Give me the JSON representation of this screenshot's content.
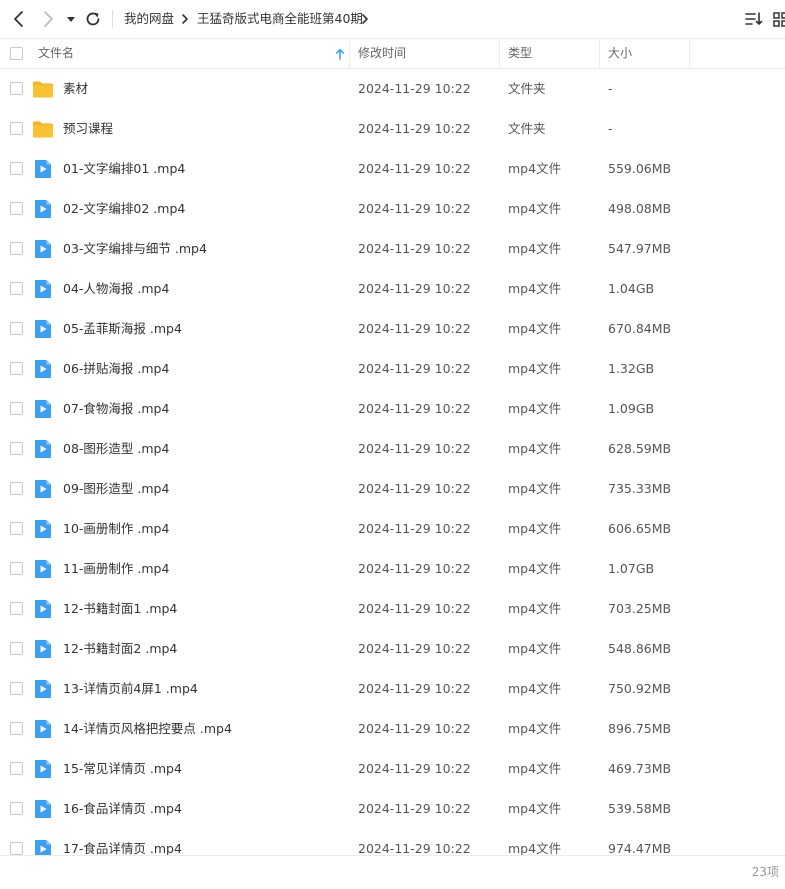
{
  "toolbar": {
    "back_icon": "chevron-left-icon",
    "forward_icon": "chevron-right-icon",
    "history_icon": "caret-down-icon",
    "refresh_icon": "refresh-icon",
    "sort_icon": "sort-list-icon",
    "view_icon": "grid-view-icon"
  },
  "breadcrumb": {
    "items": [
      "我的网盘",
      "王猛奇版式电商全能班第40期"
    ]
  },
  "columns": {
    "name": "文件名",
    "time": "修改时间",
    "type": "类型",
    "size": "大小"
  },
  "files": [
    {
      "name": "素材",
      "time": "2024-11-29 10:22",
      "type": "文件夹",
      "size": "-",
      "icon": "folder"
    },
    {
      "name": "预习课程",
      "time": "2024-11-29 10:22",
      "type": "文件夹",
      "size": "-",
      "icon": "folder"
    },
    {
      "name": "01-文字编排01 .mp4",
      "time": "2024-11-29 10:22",
      "type": "mp4文件",
      "size": "559.06MB",
      "icon": "video"
    },
    {
      "name": "02-文字编排02 .mp4",
      "time": "2024-11-29 10:22",
      "type": "mp4文件",
      "size": "498.08MB",
      "icon": "video"
    },
    {
      "name": "03-文字编排与细节 .mp4",
      "time": "2024-11-29 10:22",
      "type": "mp4文件",
      "size": "547.97MB",
      "icon": "video"
    },
    {
      "name": "04-人物海报 .mp4",
      "time": "2024-11-29 10:22",
      "type": "mp4文件",
      "size": "1.04GB",
      "icon": "video"
    },
    {
      "name": "05-孟菲斯海报 .mp4",
      "time": "2024-11-29 10:22",
      "type": "mp4文件",
      "size": "670.84MB",
      "icon": "video"
    },
    {
      "name": "06-拼贴海报 .mp4",
      "time": "2024-11-29 10:22",
      "type": "mp4文件",
      "size": "1.32GB",
      "icon": "video"
    },
    {
      "name": "07-食物海报 .mp4",
      "time": "2024-11-29 10:22",
      "type": "mp4文件",
      "size": "1.09GB",
      "icon": "video"
    },
    {
      "name": "08-图形造型 .mp4",
      "time": "2024-11-29 10:22",
      "type": "mp4文件",
      "size": "628.59MB",
      "icon": "video"
    },
    {
      "name": "09-图形造型 .mp4",
      "time": "2024-11-29 10:22",
      "type": "mp4文件",
      "size": "735.33MB",
      "icon": "video"
    },
    {
      "name": "10-画册制作 .mp4",
      "time": "2024-11-29 10:22",
      "type": "mp4文件",
      "size": "606.65MB",
      "icon": "video"
    },
    {
      "name": "11-画册制作 .mp4",
      "time": "2024-11-29 10:22",
      "type": "mp4文件",
      "size": "1.07GB",
      "icon": "video"
    },
    {
      "name": "12-书籍封面1 .mp4",
      "time": "2024-11-29 10:22",
      "type": "mp4文件",
      "size": "703.25MB",
      "icon": "video"
    },
    {
      "name": "12-书籍封面2 .mp4",
      "time": "2024-11-29 10:22",
      "type": "mp4文件",
      "size": "548.86MB",
      "icon": "video"
    },
    {
      "name": "13-详情页前4屏1 .mp4",
      "time": "2024-11-29 10:22",
      "type": "mp4文件",
      "size": "750.92MB",
      "icon": "video"
    },
    {
      "name": "14-详情页风格把控要点 .mp4",
      "time": "2024-11-29 10:22",
      "type": "mp4文件",
      "size": "896.75MB",
      "icon": "video"
    },
    {
      "name": "15-常见详情页 .mp4",
      "time": "2024-11-29 10:22",
      "type": "mp4文件",
      "size": "469.73MB",
      "icon": "video"
    },
    {
      "name": "16-食品详情页 .mp4",
      "time": "2024-11-29 10:22",
      "type": "mp4文件",
      "size": "539.58MB",
      "icon": "video"
    },
    {
      "name": "17-食品详情页 .mp4",
      "time": "2024-11-29 10:22",
      "type": "mp4文件",
      "size": "974.47MB",
      "icon": "video"
    }
  ],
  "footer": {
    "count": "23项"
  },
  "colors": {
    "folder": "#f9c232",
    "folder_tab": "#f5b21f",
    "video": "#3b9ff4",
    "sort_arrow": "#3b9ff4"
  }
}
